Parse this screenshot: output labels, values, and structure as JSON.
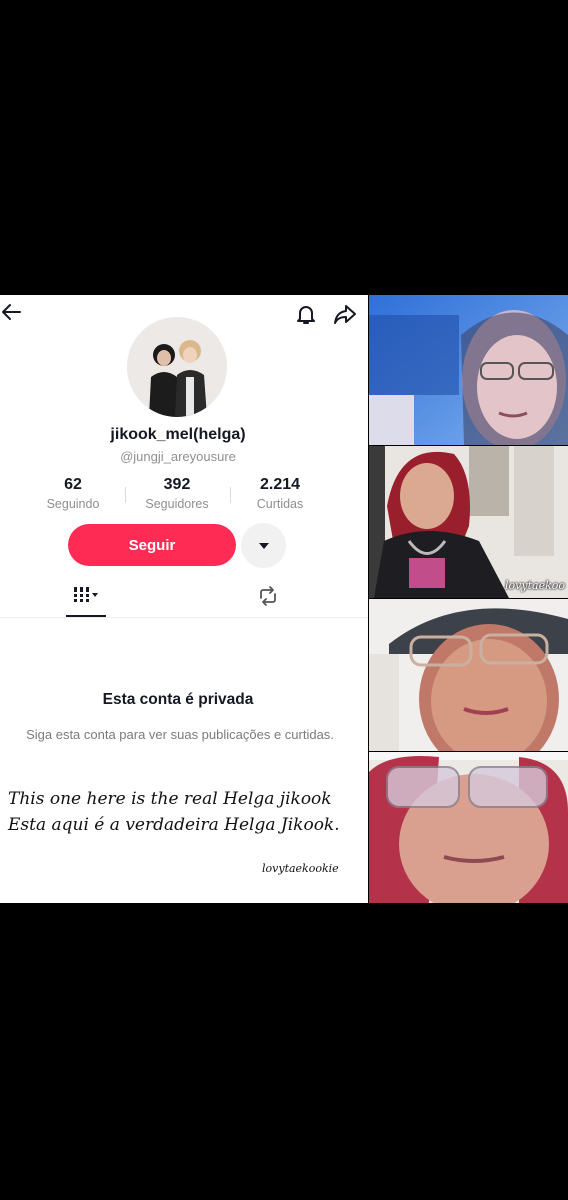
{
  "profile": {
    "display_name": "jikook_mel(helga)",
    "handle": "@jungji_areyousure",
    "stats": [
      {
        "value": "62",
        "label": "Seguindo"
      },
      {
        "value": "392",
        "label": "Seguidores"
      },
      {
        "value": "2.214",
        "label": "Curtidas"
      }
    ],
    "follow_label": "Seguir"
  },
  "icons": {
    "back": "arrow-left-icon",
    "bell": "bell-icon",
    "share": "share-icon",
    "more": "caret-down-icon",
    "grid_tab": "grid-icon",
    "repost_tab": "repost-icon"
  },
  "private": {
    "title": "Esta conta é privada",
    "subtitle": "Siga esta conta para ver suas publicações e curtidas."
  },
  "caption": {
    "line1": "This one here is the real Helga jikook",
    "line2": "Esta aqui é a verdadeira Helga Jikook.",
    "credit": "lovytaekookie"
  },
  "photos": {
    "watermark": "lovytaekoo"
  },
  "colors": {
    "follow_button": "#fe2c55",
    "background": "#000000",
    "panel": "#ffffff"
  }
}
